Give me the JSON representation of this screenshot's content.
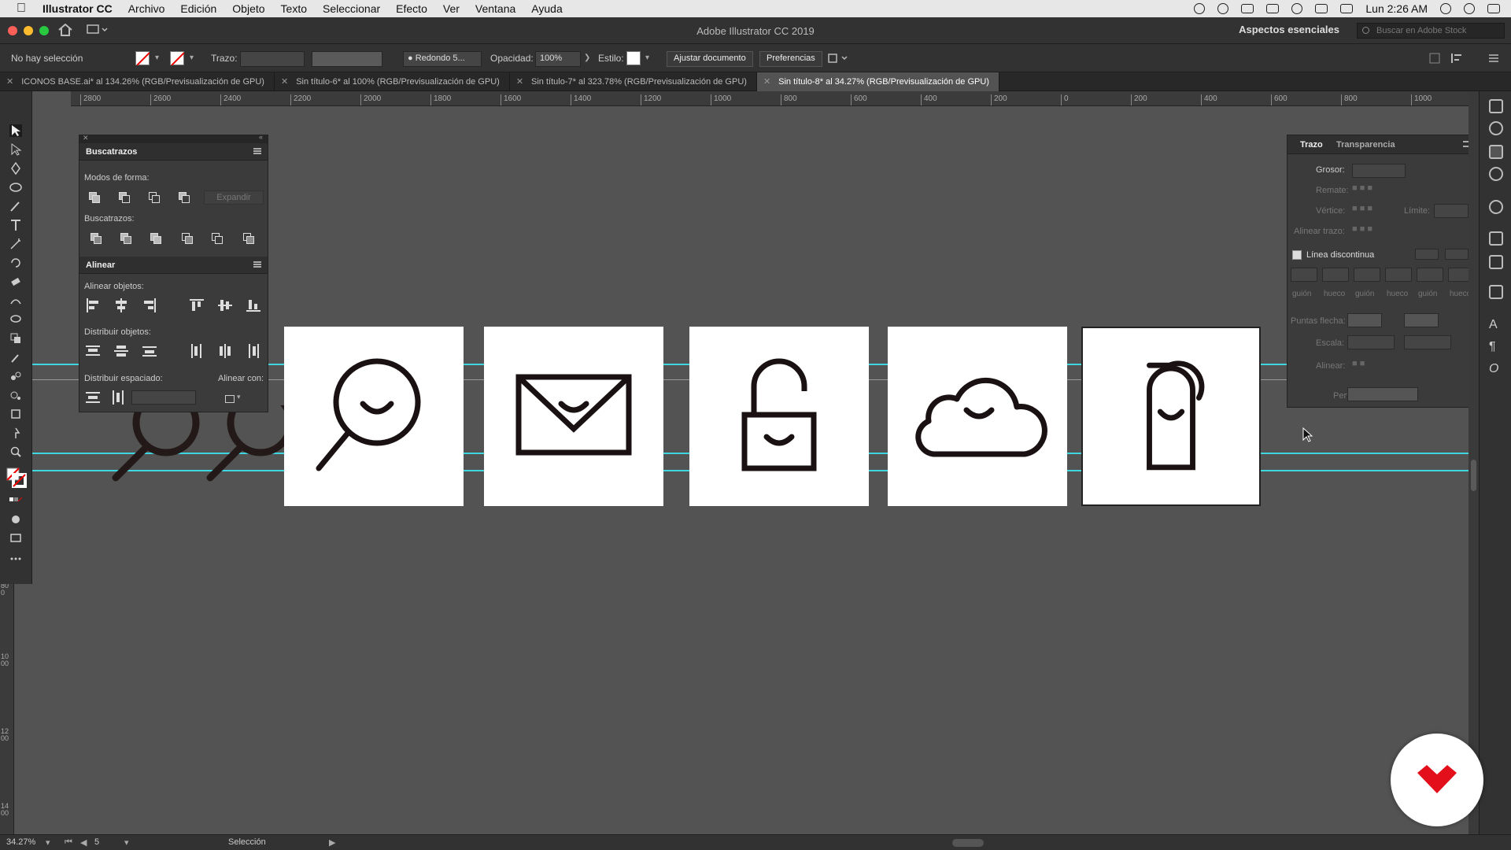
{
  "menubar": {
    "app_name": "Illustrator CC",
    "items": [
      "Archivo",
      "Edición",
      "Objeto",
      "Texto",
      "Seleccionar",
      "Efecto",
      "Ver",
      "Ventana",
      "Ayuda"
    ],
    "clock": "Lun 2:26 AM"
  },
  "window": {
    "title": "Adobe Illustrator CC 2019",
    "workspace": "Aspectos esenciales",
    "stock_search_placeholder": "Buscar en Adobe Stock"
  },
  "control_bar": {
    "selection_status": "No hay selección",
    "stroke_label": "Trazo:",
    "brush_value": "Redondo 5...",
    "opacity_label": "Opacidad:",
    "opacity_value": "100%",
    "style_label": "Estilo:",
    "fit_document_button": "Ajustar documento",
    "preferences_button": "Preferencias"
  },
  "tabs": [
    {
      "label": "ICONOS BASE.ai* al 134.26% (RGB/Previsualización de GPU)",
      "active": false
    },
    {
      "label": "Sin título-6* al 100% (RGB/Previsualización de GPU)",
      "active": false
    },
    {
      "label": "Sin título-7* al 323.78% (RGB/Previsualización de GPU)",
      "active": false
    },
    {
      "label": "Sin título-8* al 34.27% (RGB/Previsualización de GPU)",
      "active": true
    }
  ],
  "ruler_top": [
    "2800",
    "2600",
    "2400",
    "2200",
    "2000",
    "1800",
    "1600",
    "1400",
    "1200",
    "1000",
    "800",
    "600",
    "400",
    "200",
    "0",
    "200",
    "400",
    "600",
    "800",
    "1000"
  ],
  "ruler_left": [
    "800",
    "1000",
    "1200",
    "1400"
  ],
  "pathfinder_panel": {
    "title": "Buscatrazos",
    "shape_modes_label": "Modos de forma:",
    "expand_button": "Expandir",
    "pathfinders_label": "Buscatrazos:"
  },
  "align_panel": {
    "title": "Alinear",
    "align_objects_label": "Alinear objetos:",
    "distribute_objects_label": "Distribuir objetos:",
    "distribute_spacing_label": "Distribuir espaciado:",
    "align_to_label": "Alinear con:"
  },
  "stroke_panel": {
    "tab_stroke": "Trazo",
    "tab_transparency": "Transparencia",
    "weight_label": "Grosor:",
    "cap_label": "Remate:",
    "corner_label": "Vértice:",
    "limit_label": "Límite:",
    "align_stroke_label": "Alinear trazo:",
    "dashed_line_label": "Línea discontinua",
    "dash_labels": [
      "guión",
      "hueco",
      "guión",
      "hueco",
      "guión",
      "hueco"
    ],
    "arrowheads_label": "Puntas flecha:",
    "scale_label": "Escala:",
    "align_label": "Alinear:",
    "profile_label": "Perfil:"
  },
  "status_bar": {
    "zoom": "34.27%",
    "artboard_number": "5",
    "tool_name": "Selección"
  },
  "icons_on_artboards": [
    "magnifier-icon",
    "envelope-icon",
    "padlock-icon",
    "cloud-icon",
    "spray-bottle-icon"
  ],
  "colors": {
    "guide": "#3fd6e0",
    "logo_red": "#e3101b",
    "icon_stroke": "#1a1212"
  }
}
